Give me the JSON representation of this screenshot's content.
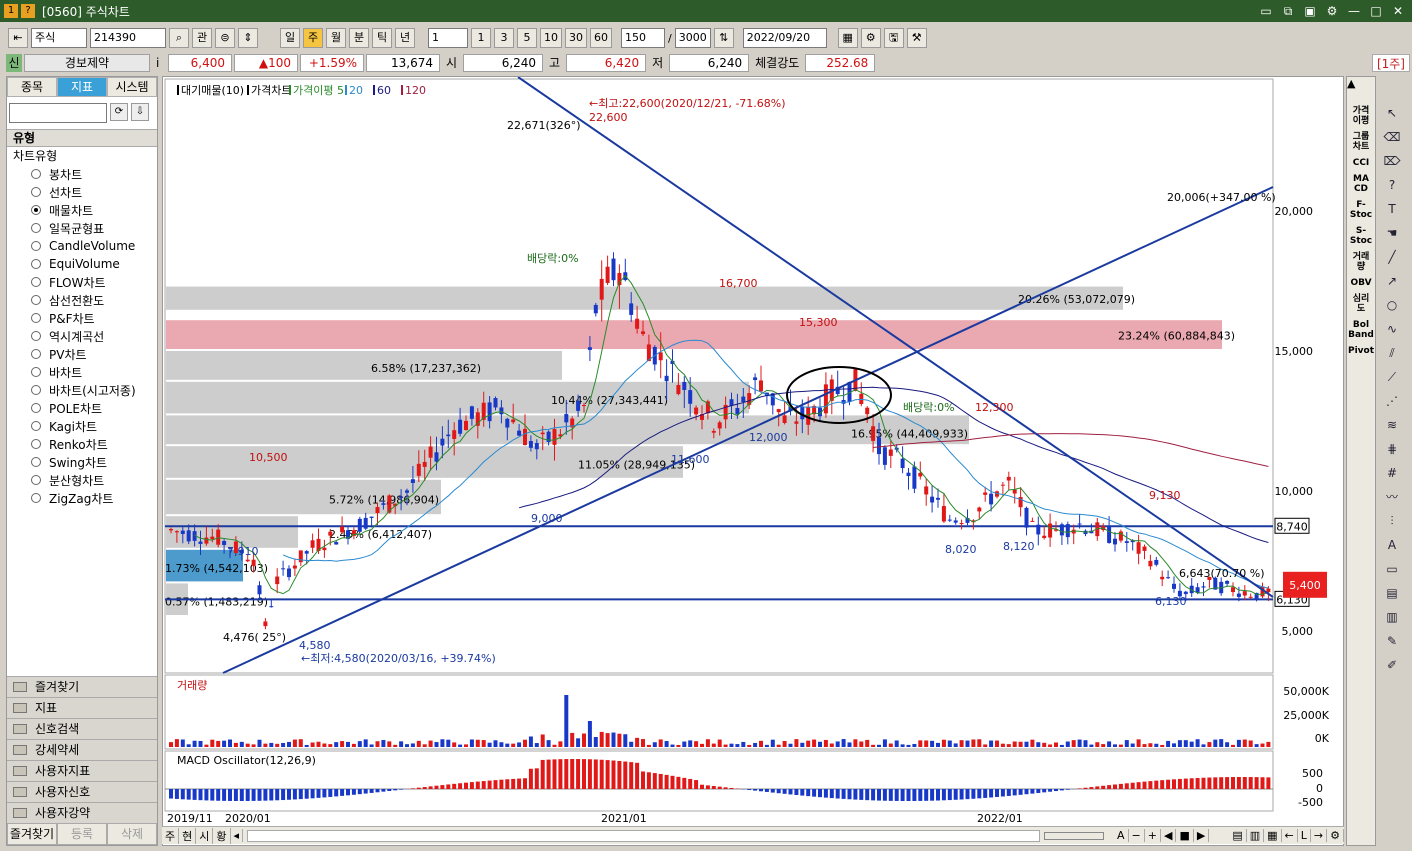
{
  "window": {
    "title": "[0560] 주식차트",
    "icons": [
      "1",
      "?"
    ]
  },
  "toolbar": {
    "market": "주식",
    "code": "214390",
    "btn_gwan": "관",
    "periods": [
      "일",
      "주",
      "월",
      "분",
      "틱",
      "년"
    ],
    "period_selected": "주",
    "interval": "1",
    "presets": [
      "1",
      "3",
      "5",
      "10",
      "30",
      "60"
    ],
    "count": "150",
    "total": "3000",
    "date": "2022/09/20"
  },
  "pricebar": {
    "badge": "신",
    "name": "경보제약",
    "info": "i",
    "price": "6,400",
    "change": "▲100",
    "change_pct": "+1.59%",
    "volume": "13,674",
    "open_label": "시",
    "open": "6,240",
    "high_label": "고",
    "high": "6,420",
    "low_label": "저",
    "low": "6,240",
    "strength_label": "체결강도",
    "strength": "252.68",
    "unit": "[1주]"
  },
  "leftpanel": {
    "tabs": [
      "종목",
      "지표",
      "시스템"
    ],
    "active_tab": "지표",
    "section": "유형",
    "root": "차트유형",
    "types": [
      "봉차트",
      "선차트",
      "매물차트",
      "일목균형표",
      "CandleVolume",
      "EquiVolume",
      "FLOW차트",
      "삼선전환도",
      "P&F차트",
      "역시계곡선",
      "PV차트",
      "바차트",
      "바차트(시고저종)",
      "POLE차트",
      "Kagi차트",
      "Renko차트",
      "Swing차트",
      "분산형차트",
      "ZigZag차트"
    ],
    "selected_type": "매물차트",
    "folders": [
      "즐겨찾기",
      "지표",
      "신호검색",
      "강세약세",
      "사용자지표",
      "사용자신호",
      "사용자강약"
    ],
    "bottom_tabs": [
      "즐겨찾기",
      "등록",
      "삭제"
    ]
  },
  "rightbar": {
    "items": [
      "가격\n이평",
      "그룹\n차트",
      "CCI",
      "MA\nCD",
      "F-\nStoc",
      "S-\nStoc",
      "거래\n량",
      "OBV",
      "심리\n도",
      "Bol\nBand",
      "Pivot"
    ]
  },
  "legend": {
    "items": [
      "대기매물(10)",
      "가격차트",
      "가격이평 5",
      "20",
      "60",
      "120"
    ],
    "colors": [
      "#000000",
      "#000000",
      "#2a8a2a",
      "#2a8ad0",
      "#1a1a80",
      "#a02040"
    ]
  },
  "volume_panel": {
    "title": "거래량",
    "ticks": [
      "50,000K",
      "25,000K",
      "0K"
    ]
  },
  "macd_panel": {
    "title": "MACD Oscillator(12,26,9)",
    "ticks": [
      "500",
      "0",
      "-500"
    ]
  },
  "x_labels": [
    "2019/11",
    "2020/01",
    "2021/01",
    "2022/01"
  ],
  "nav_labels": [
    "주",
    "현",
    "시",
    "황"
  ],
  "chart_data": {
    "type": "candlestick",
    "y_axis_labels": [
      "20,000",
      "15,000",
      "10,000",
      "5,000"
    ],
    "price_tags": [
      "8,740",
      "6,130"
    ],
    "current_tag": "5,400",
    "annotations": {
      "high": "←최고:22,600(2020/12/21, -71.68%)",
      "high_value": "22,600",
      "high_pct": "22,671(326°)",
      "low": "←최저:4,580(2020/03/16, +39.74%)",
      "low_value": "4,580",
      "low_pct": "4,476( 25°)",
      "trend": "20,006(+347.00 %)",
      "dividend1": "배당락:0%",
      "dividend2": "배당락:0%",
      "peak_16700": "16,700",
      "peak_15300": "15,300",
      "peak_12300": "12,300",
      "peak_10500": "10,500",
      "peak_9130": "9,130",
      "low_12000": "12,000",
      "low_11600": "11,600",
      "low_9000": "9,000",
      "low_8020": "8,020",
      "low_8120": "8,120",
      "low_7910": "7,910",
      "low_6130": "6,130",
      "last_pct": "6,643(70.70 %)"
    },
    "volume_profile": [
      {
        "label": "20.26% (53,072,079)"
      },
      {
        "label": "23.24% (60,884,843)"
      },
      {
        "label": "6.58% (17,237,362)"
      },
      {
        "label": "10.44% (27,343,441)"
      },
      {
        "label": "16.95% (44,409,933)"
      },
      {
        "label": "11.05% (28,949,135)"
      },
      {
        "label": "5.72% (14,986,904)"
      },
      {
        "label": "2.45% (6,412,407)"
      },
      {
        "label": "1.73% (4,542,103)"
      },
      {
        "label": "0.57% (1,483,219)"
      }
    ]
  }
}
